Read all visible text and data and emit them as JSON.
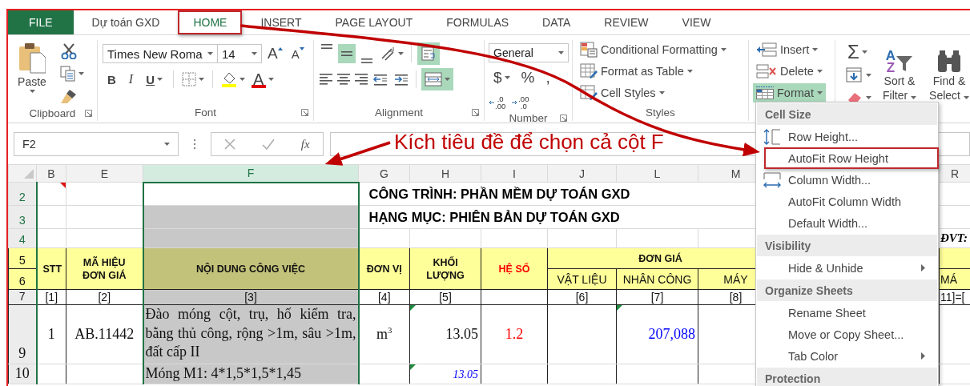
{
  "tabs": [
    {
      "label": "FILE",
      "kind": "file",
      "selected": false,
      "highlighted": false
    },
    {
      "label": "Dự toán GXD",
      "kind": "tab",
      "selected": false,
      "highlighted": false
    },
    {
      "label": "HOME",
      "kind": "tab",
      "selected": true,
      "highlighted": true
    },
    {
      "label": "INSERT",
      "kind": "tab",
      "selected": false,
      "highlighted": false
    },
    {
      "label": "PAGE LAYOUT",
      "kind": "tab",
      "selected": false,
      "highlighted": false
    },
    {
      "label": "FORMULAS",
      "kind": "tab",
      "selected": false,
      "highlighted": false
    },
    {
      "label": "DATA",
      "kind": "tab",
      "selected": false,
      "highlighted": false
    },
    {
      "label": "REVIEW",
      "kind": "tab",
      "selected": false,
      "highlighted": false
    },
    {
      "label": "VIEW",
      "kind": "tab",
      "selected": false,
      "highlighted": false
    }
  ],
  "ribbon": {
    "groups": [
      {
        "kind": "clipboard",
        "label": "Clipboard",
        "launcher": true,
        "paste": "Paste"
      },
      {
        "kind": "font",
        "label": "Font",
        "launcher": true,
        "font_name": "Times New Roma",
        "font_size": "14",
        "grow": "A",
        "shrink": "A",
        "styles": [
          "B",
          "I",
          "U"
        ],
        "font_color": "A"
      },
      {
        "kind": "alignment",
        "label": "Alignment",
        "launcher": true,
        "vertical": [
          {
            "selected": false
          },
          {
            "selected": true
          },
          {
            "selected": false
          }
        ],
        "wrap_text": {
          "on": true
        },
        "merge": {
          "on": true
        }
      },
      {
        "kind": "number",
        "label": "Number",
        "launcher": true,
        "format": "General",
        "symbols": [
          "$",
          "%",
          ","
        ],
        "decimals": [
          {
            "top": ".0",
            "bottom": ".00"
          },
          {
            "top": ".00",
            "bottom": ".0"
          }
        ]
      },
      {
        "kind": "styles",
        "label": "Styles",
        "items": [
          {
            "label": "Conditional Formatting"
          },
          {
            "label": "Format as Table"
          },
          {
            "label": "Cell Styles"
          }
        ]
      },
      {
        "kind": "cells",
        "items": [
          {
            "label": "Insert",
            "selected": false
          },
          {
            "label": "Delete",
            "selected": false
          },
          {
            "label": "Format",
            "selected": true
          }
        ]
      },
      {
        "kind": "editing",
        "sum": "Σ",
        "items": [
          {
            "label": "Sort & Filter",
            "glyphs": [
              "A",
              "Z"
            ]
          },
          {
            "label": "Find & Select"
          }
        ]
      }
    ]
  },
  "formula_bar": {
    "name_box": "F2",
    "function_button": "fx"
  },
  "annotation": {
    "callout": "Kích tiêu đề để chọn cả cột F"
  },
  "sheet": {
    "columns": [
      {
        "label": "B",
        "selected": false
      },
      {
        "label": "E",
        "selected": false
      },
      {
        "label": "F",
        "selected": true
      },
      {
        "label": "G",
        "selected": false
      },
      {
        "label": "H",
        "selected": false
      },
      {
        "label": "I",
        "selected": false
      },
      {
        "label": "J",
        "selected": false
      },
      {
        "label": "L",
        "selected": false
      },
      {
        "label": "M",
        "selected": false
      },
      {
        "label": "R",
        "selected": false
      }
    ],
    "rows": [
      {
        "number": "2",
        "kind": "title",
        "cells": [
          {
            "comment": true
          },
          {},
          {
            "active": true
          },
          {
            "kind": "title",
            "text": "CÔNG TRÌNH: PHẦN MỀM DỰ TOÁN GXD",
            "colspan": 6
          },
          {}
        ]
      },
      {
        "number": "3",
        "kind": "title",
        "cells": [
          {},
          {},
          {},
          {
            "kind": "title",
            "text": "HẠNG MỤC: PHIÊN BẢN DỰ TOÁN GXD",
            "colspan": 6
          },
          {}
        ]
      },
      {
        "number": "4",
        "kind": "blank",
        "cells": [
          {},
          {},
          {},
          {},
          {},
          {},
          {},
          {},
          {},
          {
            "kind": "note",
            "text": "ĐVT:"
          }
        ]
      },
      {
        "number": "5",
        "kind": "header",
        "cells": [
          {
            "kind": "head",
            "text": "STT",
            "rowspan": 2
          },
          {
            "kind": "head",
            "text": "MÃ HIỆU ĐƠN GIÁ",
            "rowspan": 2
          },
          {
            "kind": "head",
            "text": "NỘI DUNG CÔNG VIỆC",
            "rowspan": 2
          },
          {
            "kind": "head",
            "text": "ĐƠN VỊ",
            "rowspan": 2
          },
          {
            "kind": "head",
            "text": "KHỐI LƯỢNG",
            "rowspan": 2
          },
          {
            "kind": "head",
            "text": "HỆ SỐ",
            "color": "#ff0000",
            "rowspan": 2
          },
          {
            "kind": "group",
            "text": "ĐƠN GIÁ",
            "colspan": 3
          },
          {}
        ]
      },
      {
        "number": "6",
        "kind": "header",
        "cells": [
          {
            "kind": "sub",
            "text": "VẬT LIỆU"
          },
          {
            "kind": "sub",
            "text": "NHÂN CÔNG"
          },
          {
            "kind": "sub",
            "text": "MÁY"
          },
          {
            "kind": "sub",
            "text": "MÁ"
          }
        ]
      },
      {
        "number": "7",
        "kind": "index",
        "cells": [
          {
            "text": "[1]"
          },
          {
            "text": "[2]"
          },
          {
            "text": "[3]"
          },
          {
            "text": "[4]"
          },
          {
            "text": "[5]"
          },
          {},
          {
            "text": "[6]"
          },
          {
            "text": "[7]"
          },
          {
            "text": "[8]"
          },
          {
            "kind": "edge",
            "text": "11]=["
          }
        ]
      },
      {
        "number": "9",
        "kind": "item",
        "cells": [
          {
            "text": "1"
          },
          {
            "text": "AB.11442"
          },
          {
            "kind": "paragraph",
            "text": "Đào móng cột, trụ, hố kiểm tra, bằng thủ công, rộng >1m, sâu >1m, đất cấp II"
          },
          {
            "text": "m$^{3}$"
          },
          {
            "kind": "number",
            "text": "13.05",
            "error": true
          },
          {
            "text": "1.2",
            "color": "#ff0000"
          },
          {},
          {
            "kind": "number",
            "text": "207,088",
            "color": "#0000ff",
            "error": true
          },
          {},
          {}
        ]
      },
      {
        "number": "10",
        "kind": "detail",
        "cells": [
          {},
          {},
          {
            "kind": "paragraph",
            "text": "Móng M1: 4*1,5*1,5*1,45"
          },
          {},
          {
            "kind": "number",
            "text": "13.05",
            "color": "#0000ff",
            "italic": true,
            "error": true
          },
          {},
          {},
          {},
          {},
          {}
        ]
      }
    ]
  },
  "menu": {
    "items": [
      {
        "kind": "header",
        "label": "Cell Size"
      },
      {
        "kind": "row-size",
        "label": "Row Height...",
        "highlighted": false
      },
      {
        "kind": "item",
        "label": "AutoFit Row Height",
        "highlighted": true
      },
      {
        "kind": "column-size",
        "label": "Column Width...",
        "highlighted": false
      },
      {
        "kind": "item",
        "label": "AutoFit Column Width",
        "highlighted": false
      },
      {
        "kind": "item",
        "label": "Default Width...",
        "highlighted": false
      },
      {
        "kind": "header",
        "label": "Visibility"
      },
      {
        "kind": "submenu",
        "label": "Hide & Unhide",
        "highlighted": false
      },
      {
        "kind": "header",
        "label": "Organize Sheets"
      },
      {
        "kind": "item",
        "label": "Rename Sheet",
        "highlighted": false
      },
      {
        "kind": "item",
        "label": "Move or Copy Sheet...",
        "highlighted": false
      },
      {
        "kind": "submenu",
        "label": "Tab Color",
        "highlighted": false
      },
      {
        "kind": "header",
        "label": "Protection"
      }
    ]
  }
}
